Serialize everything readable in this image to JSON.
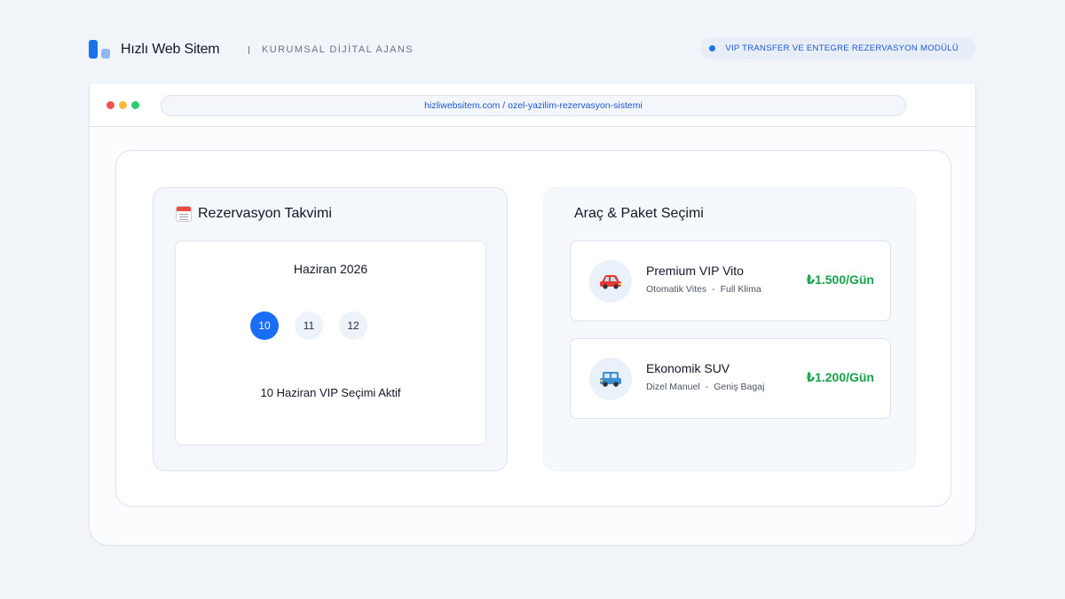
{
  "header": {
    "brand": "Hızlı Web Sitem",
    "tagline": "KURUMSAL DİJİTAL AJANS",
    "module_label": "VIP TRANSFER VE ENTEGRE REZERVASYON MODÜLÜ"
  },
  "browser": {
    "url": "hizliwebsitem.com / ozel-yazilim-rezervasyon-sistemi"
  },
  "calendar": {
    "title": "Rezervasyon Takvimi",
    "icon": "calendar-icon",
    "month": "Haziran 2026",
    "days": [
      "10",
      "11",
      "12"
    ],
    "selected_day": "10",
    "status": "10 Haziran VIP Seçimi Aktif"
  },
  "vehicles": {
    "title": "Araç & Paket Seçimi",
    "items": [
      {
        "name": "Premium VIP Vito",
        "icon": "red-car-icon",
        "specs": [
          "Otomatik Vites",
          "Full Klima"
        ],
        "price": "₺1.500/Gün"
      },
      {
        "name": "Ekonomik SUV",
        "icon": "blue-suv-icon",
        "specs": [
          "Dizel Manuel",
          "Geniş Bagaj"
        ],
        "price": "₺1.200/Gün"
      }
    ],
    "spec_separator": "-"
  },
  "colors": {
    "accent": "#1a73e8",
    "price": "#16a34a",
    "selected_day": "#1a6ef5"
  }
}
